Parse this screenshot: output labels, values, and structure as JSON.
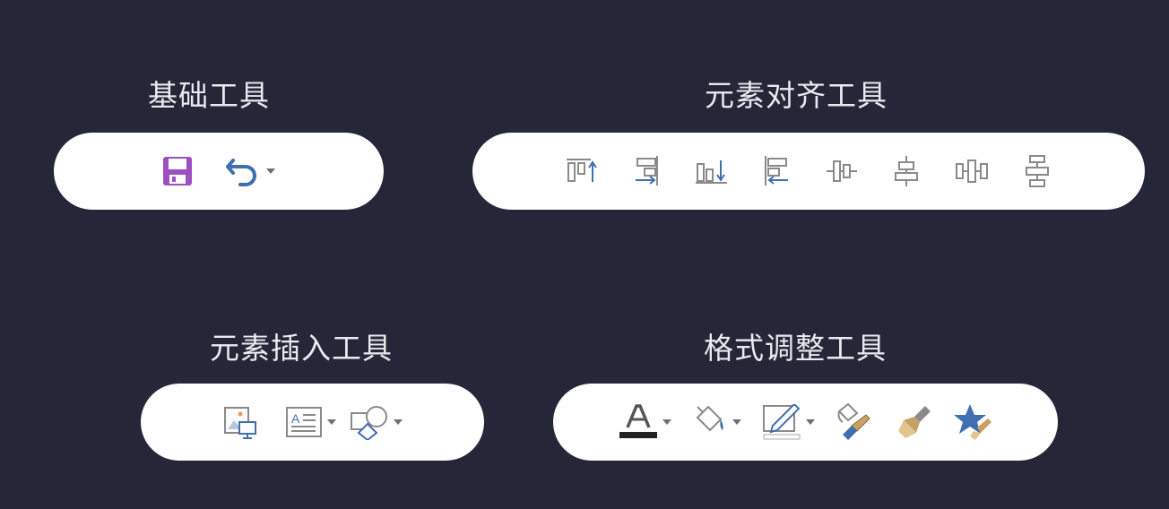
{
  "groups": {
    "basic": {
      "title": "基础工具",
      "tools": [
        "save-icon",
        "undo-icon"
      ]
    },
    "align": {
      "title": "元素对齐工具",
      "tools": [
        "align-top-icon",
        "align-right-icon",
        "align-bottom-icon",
        "align-left-icon",
        "align-middle-icon",
        "align-center-icon",
        "distribute-horizontal-icon",
        "distribute-vertical-icon"
      ]
    },
    "insert": {
      "title": "元素插入工具",
      "tools": [
        "insert-image-icon",
        "insert-textbox-icon",
        "insert-shape-icon"
      ]
    },
    "format": {
      "title": "格式调整工具",
      "tools": [
        "font-color-icon",
        "fill-color-icon",
        "border-color-icon",
        "format-painter-icon",
        "clear-format-icon",
        "special-effects-icon"
      ]
    }
  },
  "colors": {
    "background": "#262639",
    "pill": "#ffffff",
    "title": "#e9e9ee",
    "icon_gray": "#8a8a8a",
    "save_purple": "#9b4fc0",
    "undo_blue": "#3f6fb0"
  }
}
